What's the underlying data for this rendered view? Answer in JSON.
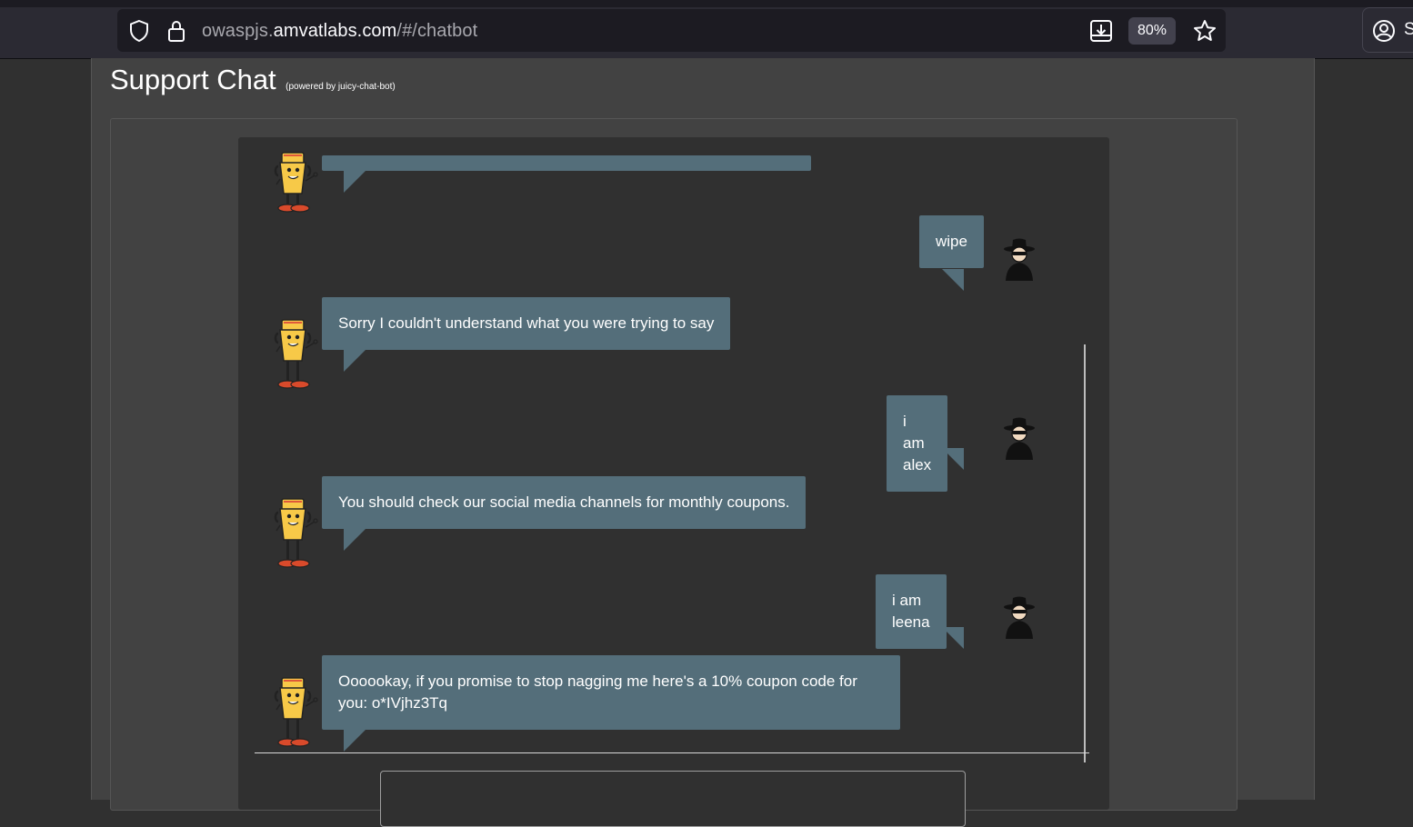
{
  "browser": {
    "url_prefix": "owaspjs.",
    "url_domain": "amvatlabs.com",
    "url_path": "/#/chatbot",
    "zoom": "80%",
    "account_label": "S",
    "icons": [
      "shield-icon",
      "lock-icon",
      "download-icon",
      "star-icon",
      "account-icon"
    ]
  },
  "page": {
    "title": "Support Chat",
    "powered_by": "(powered by juicy-chat-bot)"
  },
  "chat": {
    "messages": [
      {
        "sender": "bot",
        "text": ""
      },
      {
        "sender": "user",
        "text": "wipe"
      },
      {
        "sender": "bot",
        "text": "Sorry I couldn't understand what you were trying to say"
      },
      {
        "sender": "user",
        "text": "i am alex"
      },
      {
        "sender": "bot",
        "text": "You should check our social media channels for monthly coupons."
      },
      {
        "sender": "user",
        "text": "i am leena"
      },
      {
        "sender": "bot",
        "text": "Oooookay, if you promise to stop nagging me here's a 10% coupon code for you: o*IVjhz3Tq"
      }
    ],
    "colors": {
      "bubble": "#546e7a",
      "pane": "#303030",
      "card": "#424242"
    }
  }
}
